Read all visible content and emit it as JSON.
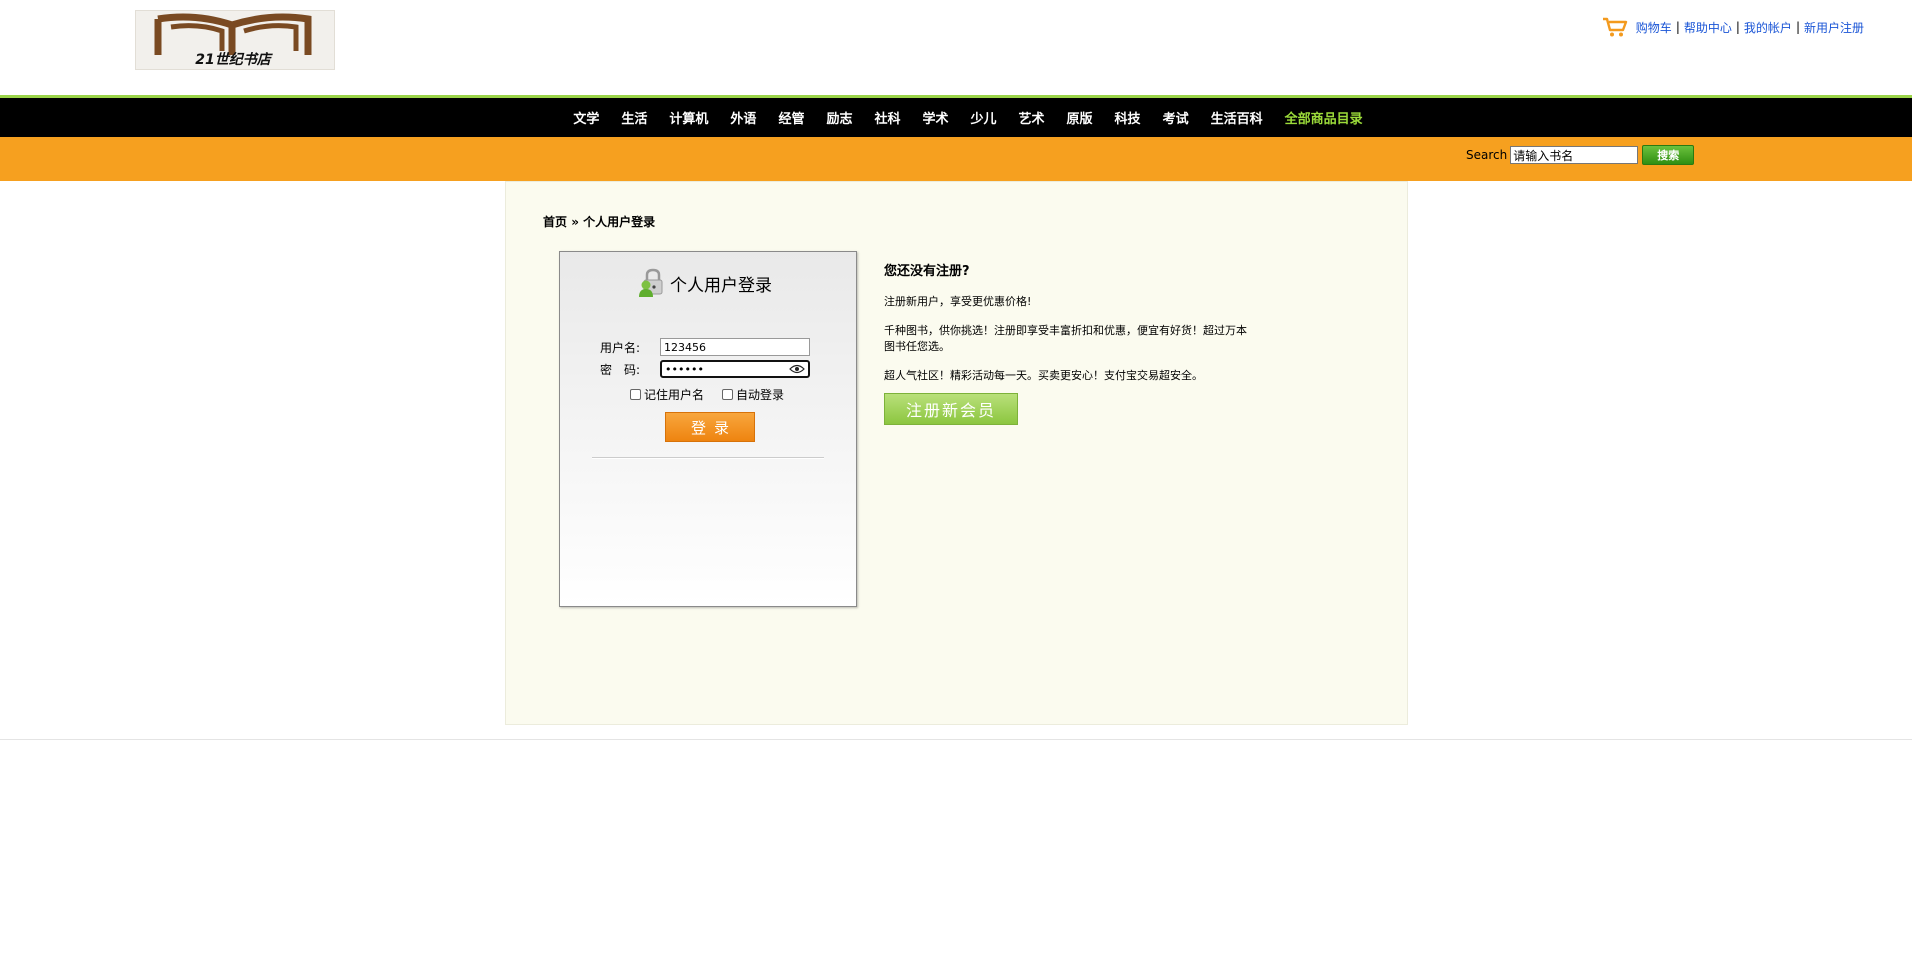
{
  "header": {
    "logo_text": "21世纪书店",
    "links": [
      "购物车",
      "帮助中心",
      "我的帐户",
      "新用户注册"
    ],
    "link_separator": "|"
  },
  "nav": {
    "items": [
      "文学",
      "生活",
      "计算机",
      "外语",
      "经管",
      "励志",
      "社科",
      "学术",
      "少儿",
      "艺术",
      "原版",
      "科技",
      "考试",
      "生活百科"
    ],
    "all_label": "全部商品目录"
  },
  "search": {
    "label": "Search",
    "value": "请输入书名",
    "button": "搜索"
  },
  "breadcrumb": {
    "home": "首页",
    "separator": " » ",
    "current": "个人用户登录"
  },
  "login": {
    "title": "个人用户登录",
    "username_label": "用户名:",
    "username_value": "123456",
    "password_label": "密　码:",
    "password_value": "••••••",
    "remember_label": "记住用户名",
    "autologin_label": "自动登录",
    "submit_label": "登录"
  },
  "register": {
    "title": "您还没有注册?",
    "p1": "注册新用户，享受更优惠价格!",
    "p2": "千种图书，供你挑选！注册即享受丰富折扣和优惠，便宜有好货！超过万本图书任您选。",
    "p3": "超人气社区！精彩活动每一天。买卖更安心！支付宝交易超安全。",
    "button": "注册新会员"
  },
  "colors": {
    "nav_bg": "#000000",
    "accent_orange": "#f6a01f",
    "accent_green": "#9bd449",
    "link_blue": "#1a55d6"
  }
}
